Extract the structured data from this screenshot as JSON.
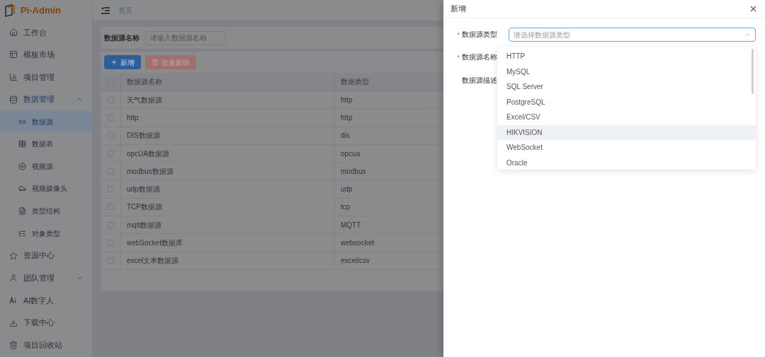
{
  "logo": {
    "text": "Pi-Admin"
  },
  "sidebar": {
    "items": [
      {
        "label": "工作台",
        "kind": "item",
        "selected": false
      },
      {
        "label": "模板市场",
        "kind": "item",
        "selected": false
      },
      {
        "label": "项目管理",
        "kind": "item",
        "selected": false
      },
      {
        "label": "数据管理",
        "kind": "group",
        "selected": false,
        "expanded": true,
        "children": [
          {
            "label": "数据源",
            "selected": true
          },
          {
            "label": "数据表",
            "selected": false
          },
          {
            "label": "视频源",
            "selected": false
          },
          {
            "label": "视频摄像头",
            "selected": false
          },
          {
            "label": "类型结构",
            "selected": false
          },
          {
            "label": "对象类型",
            "selected": false
          }
        ]
      },
      {
        "label": "资源中心",
        "kind": "item",
        "selected": false
      },
      {
        "label": "团队管理",
        "kind": "group",
        "selected": false,
        "expanded": false
      },
      {
        "label": "AI数字人",
        "kind": "item",
        "selected": false
      },
      {
        "label": "下载中心",
        "kind": "item",
        "selected": false
      },
      {
        "label": "项目回收站",
        "kind": "item",
        "selected": false
      }
    ]
  },
  "breadcrumb": "首页",
  "search": {
    "label": "数据源名称",
    "placeholder": "请输入数据源名称"
  },
  "toolbar": {
    "add": "新增",
    "delete": "批量删除"
  },
  "table": {
    "all_checked": false,
    "columns": [
      "数据源名称",
      "数据类型"
    ],
    "rows": [
      {
        "cells": [
          "天气数据源",
          "http"
        ],
        "checked": false
      },
      {
        "cells": [
          "http",
          "http"
        ],
        "checked": false
      },
      {
        "cells": [
          "DIS数据源",
          "dis"
        ],
        "checked": false
      },
      {
        "cells": [
          "opcUA数据源",
          "opcua"
        ],
        "checked": false
      },
      {
        "cells": [
          "modbus数据源",
          "modbus"
        ],
        "checked": false
      },
      {
        "cells": [
          "udp数据源",
          "udp"
        ],
        "checked": false
      },
      {
        "cells": [
          "TCP数据源",
          "tcp"
        ],
        "checked": false
      },
      {
        "cells": [
          "mqtt数据源",
          "MQTT"
        ],
        "checked": false
      },
      {
        "cells": [
          "webSocket数据库",
          "websocket"
        ],
        "checked": false
      },
      {
        "cells": [
          "excel文本数据源",
          "excel/csv"
        ],
        "checked": false
      }
    ]
  },
  "drawer": {
    "title": "新增",
    "required_mark": "*",
    "fields": [
      {
        "label": "数据源类型",
        "required": true,
        "placeholder": "请选择数据源类型"
      },
      {
        "label": "数据源名称",
        "required": true
      },
      {
        "label": "数据源描述",
        "required": false
      }
    ],
    "dropdown": {
      "options": [
        {
          "label": "HTTP",
          "selected": false
        },
        {
          "label": "MySQL",
          "selected": false
        },
        {
          "label": "SQL Server",
          "selected": false
        },
        {
          "label": "PostgreSQL",
          "selected": false
        },
        {
          "label": "Excel/CSV",
          "selected": false
        },
        {
          "label": "HIKVISION",
          "selected": true
        },
        {
          "label": "WebSocket",
          "selected": false
        },
        {
          "label": "Oracle",
          "selected": false
        }
      ]
    }
  }
}
